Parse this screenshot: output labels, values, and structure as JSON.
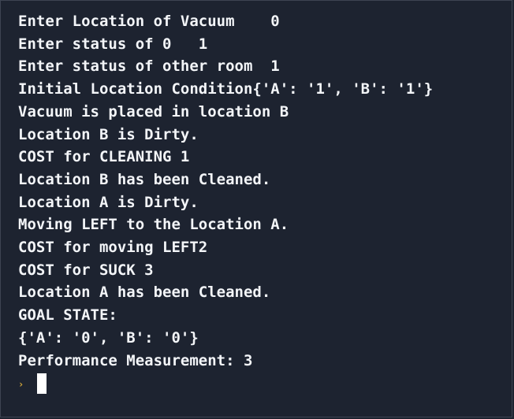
{
  "console": {
    "lines": [
      "Enter Location of Vacuum    0",
      "Enter status of 0   1",
      "Enter status of other room  1",
      "Initial Location Condition{'A': '1', 'B': '1'}",
      "Vacuum is placed in location B",
      "Location B is Dirty.",
      "COST for CLEANING 1",
      "Location B has been Cleaned.",
      "Location A is Dirty.",
      "Moving LEFT to the Location A.",
      "COST for moving LEFT2",
      "COST for SUCK 3",
      "Location A has been Cleaned.",
      "GOAL STATE:",
      "{'A': '0', 'B': '0'}",
      "Performance Measurement: 3"
    ],
    "prompt_glyph": "›",
    "prompt_icon": "chevron-right-icon",
    "colors": {
      "background": "#1d2330",
      "text": "#f3f5f8",
      "prompt": "#d5a93a",
      "cursor": "#ffffff"
    }
  }
}
